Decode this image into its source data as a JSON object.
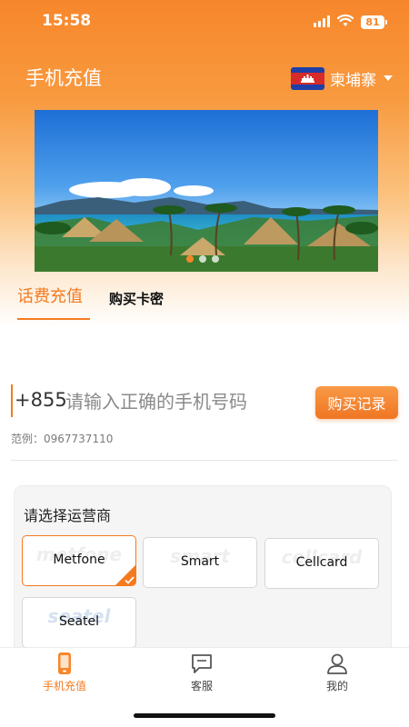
{
  "status_bar": {
    "time": "15:58",
    "battery": "81"
  },
  "header": {
    "title": "手机充值",
    "country": "柬埔寨"
  },
  "banner": {
    "slides": 3,
    "active_slide": 1
  },
  "tabs": [
    {
      "label": "话费充值",
      "active": true
    },
    {
      "label": "购买卡密",
      "active": false
    }
  ],
  "phone": {
    "prefix": "+855",
    "placeholder": "请输入正确的手机号码",
    "value": "",
    "history_button": "购买记录",
    "example": "范例：0967737110"
  },
  "operators": {
    "title": "请选择运营商",
    "items": [
      {
        "name": "Metfone",
        "selected": true
      },
      {
        "name": "Smart",
        "selected": false
      },
      {
        "name": "Cellcard",
        "selected": false
      },
      {
        "name": "Seatel",
        "selected": false
      }
    ]
  },
  "bottom_nav": [
    {
      "label": "手机充值",
      "icon": "phone-icon",
      "active": true
    },
    {
      "label": "客服",
      "icon": "chat-icon",
      "active": false
    },
    {
      "label": "我的",
      "icon": "user-icon",
      "active": false
    }
  ],
  "colors": {
    "accent": "#f47a1f",
    "header_gradient_top": "#f7862b"
  }
}
